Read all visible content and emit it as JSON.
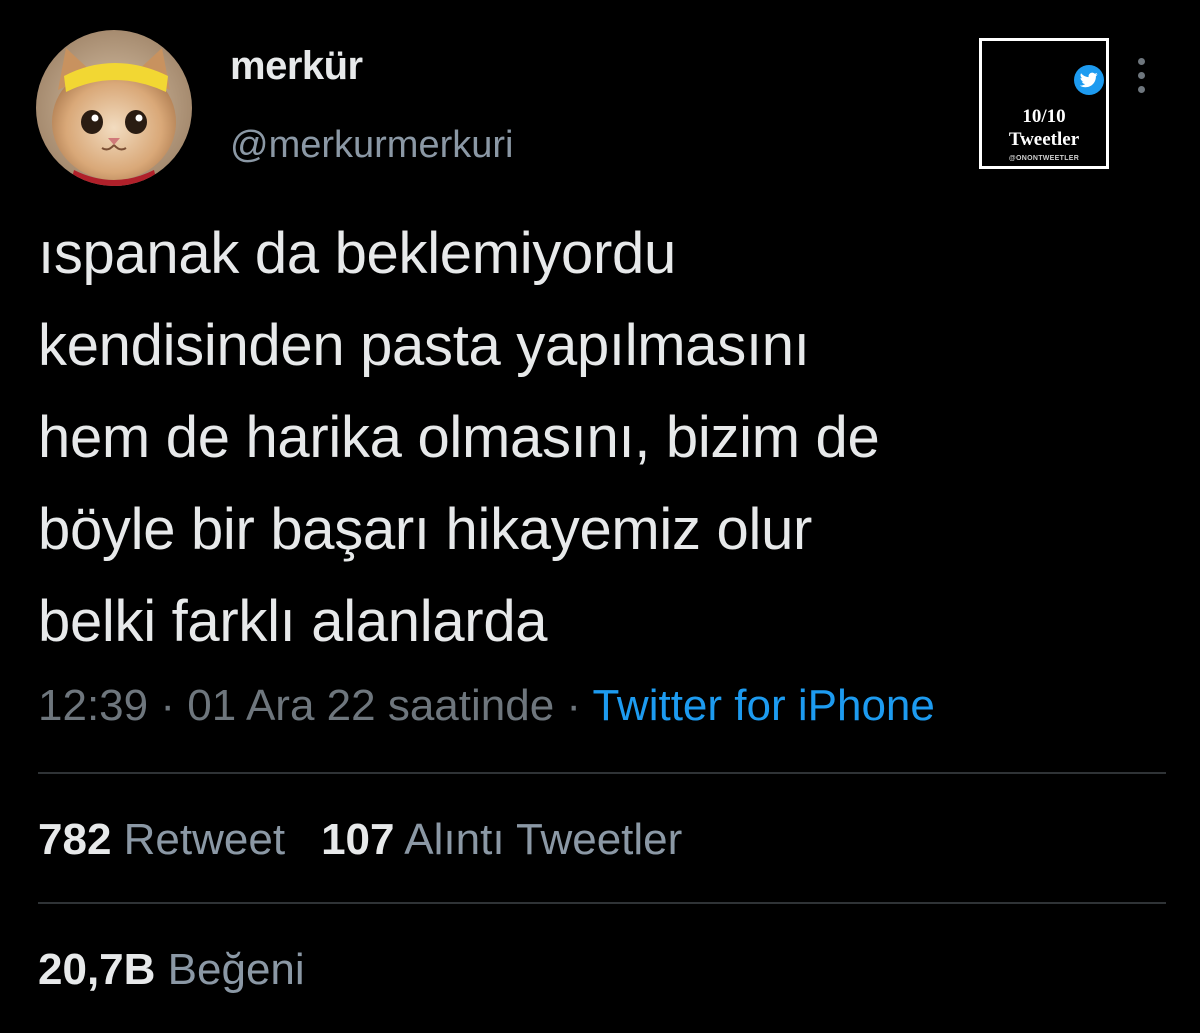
{
  "author": {
    "display_name": "merkür",
    "handle": "@merkurmerkuri",
    "avatar": "cat-with-yellow-headband-avatar"
  },
  "badge": {
    "icon": "twitter-bird-icon",
    "count": "10/10",
    "title": "Tweetler",
    "handle": "@ONONTWEETLER"
  },
  "tweet": {
    "lines": [
      "ıspanak da beklemiyordu",
      "kendisinden pasta yapılmasını",
      "hem de harika olmasını, bizim de",
      "böyle bir başarı hikayemiz olur",
      "belki farklı alanlarda"
    ]
  },
  "meta": {
    "time": "12:39",
    "separator": " · ",
    "date": "01 Ara 22 saatinde",
    "source": "Twitter for iPhone"
  },
  "stats": {
    "retweets": {
      "count": "782",
      "label": "Retweet"
    },
    "quotes": {
      "count": "107",
      "label": "Alıntı Tweetler"
    },
    "likes": {
      "count": "20,7B",
      "label": "Beğeni"
    }
  },
  "colors": {
    "background": "#000000",
    "text": "#e7e9ea",
    "secondary": "#6e767d",
    "link": "#1d9bf0",
    "divider": "#2f3336"
  }
}
